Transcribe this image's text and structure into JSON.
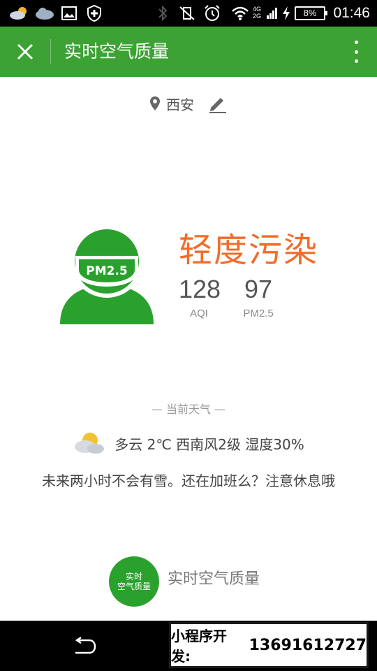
{
  "status_bar": {
    "time": "01:46",
    "battery": "8%",
    "network_top": "4G",
    "network_bottom": "2G"
  },
  "title_bar": {
    "title": "实时空气质量",
    "close_icon": "close-icon",
    "more_icon": "more-vertical-icon"
  },
  "location": {
    "city": "西安",
    "pin_icon": "location-pin-icon",
    "edit_icon": "edit-pencil-icon"
  },
  "air_quality": {
    "mask_label": "PM2.5",
    "level": "轻度污染",
    "level_color": "#f26b2a",
    "aqi_value": "128",
    "aqi_label": "AQI",
    "pm25_value": "97",
    "pm25_label": "PM2.5"
  },
  "weather": {
    "section_title": "— 当前天气 —",
    "summary": "多云 2℃ 西南风2级 湿度30%",
    "icon": "partly-cloudy-icon",
    "tip": "未来两小时不会有雪。还在加班么？注意休息哦"
  },
  "brand": {
    "badge_line1": "实时",
    "badge_line2": "空气质量",
    "name": "实时空气质量",
    "color": "#2aa12d"
  },
  "nav_bar": {
    "back_icon": "back-icon"
  },
  "promo": {
    "label": "小程序开发:",
    "number": "13691612727"
  },
  "colors": {
    "accent": "#3ba233"
  }
}
